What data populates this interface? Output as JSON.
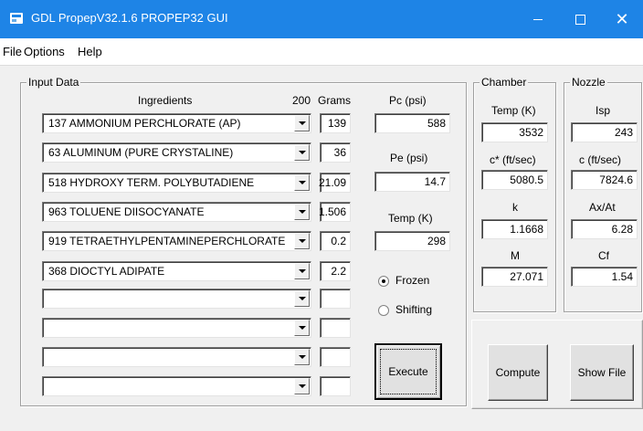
{
  "window": {
    "title": "GDL PropepV32.1.6  PROPEP32 GUI",
    "minimize_glyph": "",
    "close_glyph": "✕"
  },
  "menu": [
    "File",
    "Options",
    "Help"
  ],
  "input_data": {
    "legend": "Input Data",
    "header_ingredients": "Ingredients",
    "header_total": "200",
    "header_grams": "Grams",
    "rows": [
      {
        "ingredient": "137 AMMONIUM PERCHLORATE (AP)",
        "grams": "139"
      },
      {
        "ingredient": " 63 ALUMINUM (PURE CRYSTALINE)",
        "grams": "36"
      },
      {
        "ingredient": "518 HYDROXY TERM. POLYBUTADIENE",
        "grams": "21.09"
      },
      {
        "ingredient": "963 TOLUENE DIISOCYANATE",
        "grams": "1.506"
      },
      {
        "ingredient": "919 TETRAETHYLPENTAMINEPERCHLORATE",
        "grams": "0.2"
      },
      {
        "ingredient": "368 DIOCTYL ADIPATE",
        "grams": "2.2"
      },
      {
        "ingredient": "",
        "grams": ""
      },
      {
        "ingredient": "",
        "grams": ""
      },
      {
        "ingredient": "",
        "grams": ""
      },
      {
        "ingredient": "",
        "grams": ""
      }
    ],
    "pc_label": "Pc (psi)",
    "pc_value": "588",
    "pe_label": "Pe (psi)",
    "pe_value": "14.7",
    "temp_label": "Temp (K)",
    "temp_value": "298",
    "frozen_label": "Frozen",
    "shifting_label": "Shifting",
    "selected_mode": "Frozen",
    "execute_label": "Execute"
  },
  "chamber": {
    "legend": "Chamber",
    "temp_label": "Temp (K)",
    "temp_value": "3532",
    "cstar_label": "c* (ft/sec)",
    "cstar_value": "5080.5",
    "k_label": "k",
    "k_value": "1.1668",
    "m_label": "M",
    "m_value": "27.071"
  },
  "nozzle": {
    "legend": "Nozzle",
    "isp_label": "Isp",
    "isp_value": "243",
    "c_label": "c (ft/sec)",
    "c_value": "7824.6",
    "axat_label": "Ax/At",
    "axat_value": "6.28",
    "cf_label": "Cf",
    "cf_value": "1.54"
  },
  "actions": {
    "compute_label": "Compute",
    "show_file_label": "Show File"
  }
}
